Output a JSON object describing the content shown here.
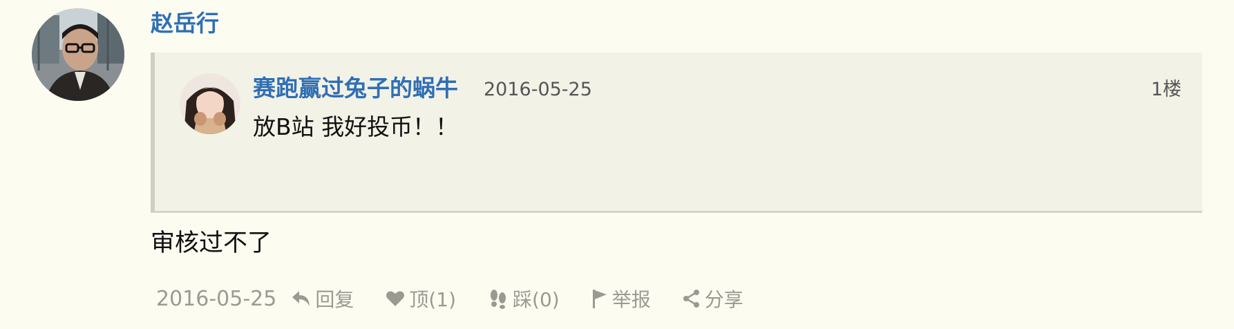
{
  "comment": {
    "author": "赵岳行",
    "text": "审核过不了",
    "date": "2016-05-25"
  },
  "quote": {
    "user": "赛跑赢过兔子的蜗牛",
    "date": "2016-05-25",
    "floor": "1楼",
    "text": "放B站 我好投币！！"
  },
  "actions": {
    "reply": "回复",
    "upvote": "顶(1)",
    "downvote": "踩(0)",
    "report": "举报",
    "share": "分享"
  },
  "icons": [
    "reply-icon",
    "heart-icon",
    "footprint-icon",
    "flag-icon",
    "share-icon"
  ],
  "colors": {
    "link": "#2f6fb5",
    "muted": "#9a9a92",
    "quote_bg": "#f3f2e7",
    "page_bg": "#fcfcf1"
  }
}
